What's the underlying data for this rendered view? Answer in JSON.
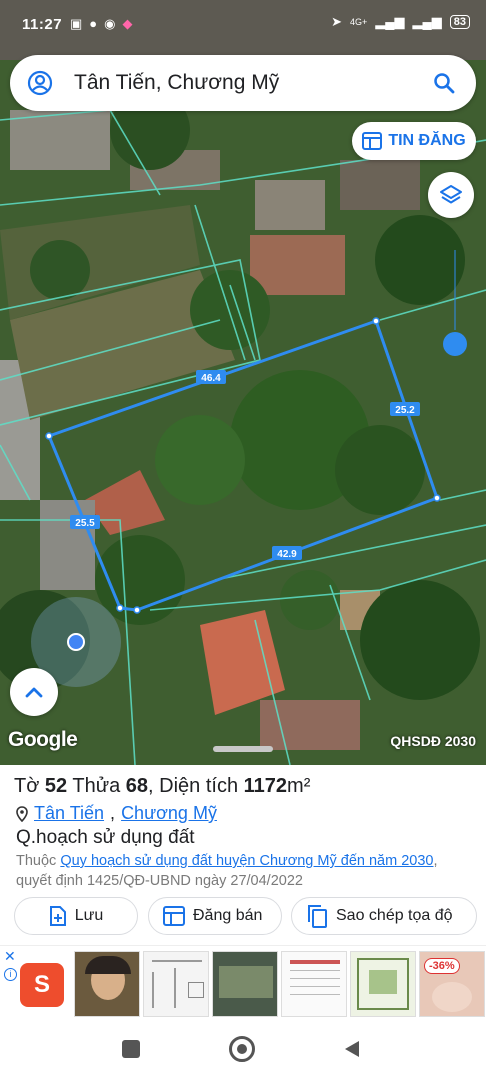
{
  "status": {
    "time": "11:27",
    "battery": "83",
    "network": "4G+"
  },
  "search": {
    "query": "Tân Tiến, Chương Mỹ"
  },
  "buttons": {
    "tin_dang": "TIN ĐĂNG"
  },
  "map": {
    "plot_edges": [
      "46.4",
      "25.2",
      "42.9",
      "25.5"
    ],
    "logo": "Google",
    "plan_label": "QHSDĐ 2030"
  },
  "parcel": {
    "to_label": "Tờ",
    "to_value": "52",
    "thua_label": "Thửa",
    "thua_value": "68",
    "area_label": "Diện tích",
    "area_value": "1172",
    "area_unit": "m²"
  },
  "location": {
    "commune": "Tân Tiến",
    "district": "Chương Mỹ"
  },
  "planning": {
    "title": "Q.hoạch sử dụng đất",
    "prefix": "Thuộc",
    "link": "Quy hoạch sử dụng đất huyện Chương Mỹ đến năm 2030",
    "suffix": ", quyết định 1425/QĐ-UBND ngày 27/04/2022"
  },
  "actions": {
    "save": "Lưu",
    "post": "Đăng bán",
    "copy_coords": "Sao chép tọa độ"
  },
  "ad": {
    "discount": "-36%"
  },
  "colors": {
    "accent": "#1a73e8",
    "plot_line": "#2f8cf0",
    "shopee": "#ee4d2d"
  }
}
